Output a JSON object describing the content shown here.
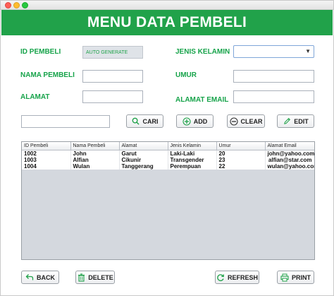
{
  "window": {
    "title": ""
  },
  "banner": {
    "title": "MENU DATA PEMBELI",
    "color": "#21a24a"
  },
  "form": {
    "id_label": "ID PEMBELI",
    "id_value": "AUTO GENERATE",
    "nama_label": "NAMA PEMBELI",
    "nama_value": "",
    "alamat_label": "ALAMAT",
    "alamat_value": "",
    "jenis_kelamin_label": "JENIS KELAMIN",
    "jenis_kelamin_value": "",
    "umur_label": "UMUR",
    "umur_value": "",
    "email_label": "ALAMAT EMAIL",
    "email_value": "",
    "search_value": ""
  },
  "toolbar": {
    "cari_label": "CARI",
    "add_label": "ADD",
    "clear_label": "CLEAR",
    "edit_label": "EDIT"
  },
  "table": {
    "headers": [
      "ID Pembeli",
      "Nama Pembeli",
      "Alamat",
      "Jenis Kelamin",
      "Umur",
      "Alamat Email"
    ],
    "rows": [
      [
        "1002",
        "John",
        "Garut",
        "Laki-Laki",
        "20",
        "john@yahoo.com"
      ],
      [
        "1003",
        "Alfian",
        "Cikunir",
        "Transgender",
        "23",
        "alfian@star.com"
      ],
      [
        "1004",
        "Wulan",
        "Tanggerang",
        "Perempuan",
        "22",
        "wulan@yahoo.com"
      ]
    ]
  },
  "footer": {
    "back_label": "BACK",
    "delete_label": "DELETE",
    "refresh_label": "REFRESH",
    "print_label": "PRINT"
  },
  "icons": {
    "cari": "search-icon",
    "add": "plus-circle-icon",
    "clear": "minus-circle-icon",
    "edit": "pencil-icon",
    "back": "back-arrow-icon",
    "delete": "trash-icon",
    "refresh": "refresh-icon",
    "print": "printer-icon"
  }
}
